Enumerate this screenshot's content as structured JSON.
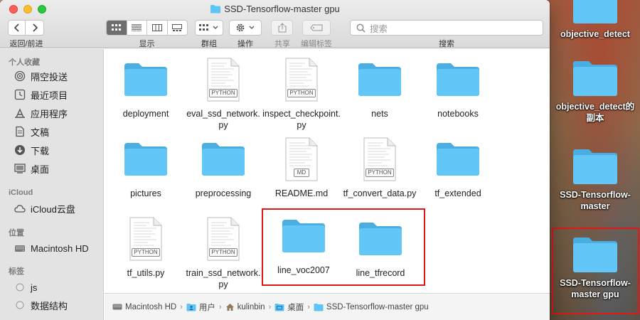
{
  "window": {
    "title": "SSD-Tensorflow-master gpu"
  },
  "toolbar": {
    "nav_label": "返回/前进",
    "view_label": "显示",
    "group_label": "群组",
    "action_label": "操作",
    "share_label": "共享",
    "tags_label": "编辑标签",
    "search_label": "搜索",
    "search_placeholder": "搜索",
    "view_modes": [
      "icon",
      "list",
      "column",
      "gallery"
    ],
    "active_view": "icon"
  },
  "sidebar": {
    "sections": [
      {
        "header": "个人收藏",
        "items": [
          {
            "label": "隔空投送",
            "icon": "airdrop-icon"
          },
          {
            "label": "最近项目",
            "icon": "clock-icon"
          },
          {
            "label": "应用程序",
            "icon": "applications-icon"
          },
          {
            "label": "文稿",
            "icon": "document-icon"
          },
          {
            "label": "下载",
            "icon": "download-icon"
          },
          {
            "label": "桌面",
            "icon": "desktop-icon"
          }
        ]
      },
      {
        "header": "iCloud",
        "items": [
          {
            "label": "iCloud云盘",
            "icon": "cloud-icon"
          }
        ]
      },
      {
        "header": "位置",
        "items": [
          {
            "label": "Macintosh HD",
            "icon": "hard-drive-icon"
          }
        ]
      },
      {
        "header": "标签",
        "items": [
          {
            "label": "js",
            "icon": "tag-dot-icon"
          },
          {
            "label": "数据结构",
            "icon": "tag-dot-icon"
          }
        ]
      }
    ]
  },
  "files": [
    {
      "name": "deployment",
      "kind": "folder"
    },
    {
      "name": "eval_ssd_network.py",
      "kind": "python",
      "tag": "PYTHON"
    },
    {
      "name": "inspect_checkpoint.py",
      "kind": "python",
      "tag": "PYTHON"
    },
    {
      "name": "nets",
      "kind": "folder"
    },
    {
      "name": "notebooks",
      "kind": "folder"
    },
    {
      "name": "pictures",
      "kind": "folder"
    },
    {
      "name": "preprocessing",
      "kind": "folder"
    },
    {
      "name": "README.md",
      "kind": "markdown",
      "tag": "MD"
    },
    {
      "name": "tf_convert_data.py",
      "kind": "python",
      "tag": "PYTHON"
    },
    {
      "name": "tf_extended",
      "kind": "folder"
    },
    {
      "name": "tf_utils.py",
      "kind": "python",
      "tag": "PYTHON"
    },
    {
      "name": "train_ssd_network.py",
      "kind": "python",
      "tag": "PYTHON"
    },
    {
      "name": "line_voc2007",
      "kind": "folder"
    },
    {
      "name": "line_tfrecord",
      "kind": "folder"
    }
  ],
  "pathbar": [
    {
      "label": "Macintosh HD",
      "icon": "hard-drive-icon"
    },
    {
      "label": "用户",
      "icon": "users-folder-icon"
    },
    {
      "label": "kulinbin",
      "icon": "home-icon"
    },
    {
      "label": "桌面",
      "icon": "desktop-folder-icon"
    },
    {
      "label": "SSD-Tensorflow-master gpu",
      "icon": "folder-icon"
    }
  ],
  "desktop": {
    "items": [
      {
        "label": "objective_detect"
      },
      {
        "label": "objective_detect的副本"
      },
      {
        "label": "SSD-Tensorflow-master"
      },
      {
        "label": "SSD-Tensorflow-master gpu"
      }
    ]
  },
  "colors": {
    "folder": "#5ec3f5",
    "folder_dark": "#4aaee3",
    "highlight": "#e01818",
    "active_segment": "#6e6e6e"
  }
}
